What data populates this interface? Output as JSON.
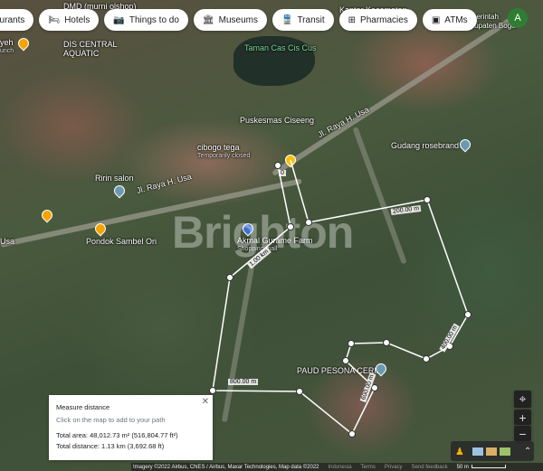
{
  "filter_chips": [
    {
      "label": "aurants",
      "icon": "restaurant-icon"
    },
    {
      "label": "Hotels",
      "icon": "bed-icon"
    },
    {
      "label": "Things to do",
      "icon": "camera-icon"
    },
    {
      "label": "Museums",
      "icon": "museum-icon"
    },
    {
      "label": "Transit",
      "icon": "train-icon"
    },
    {
      "label": "Pharmacies",
      "icon": "pharmacy-icon"
    },
    {
      "label": "ATMs",
      "icon": "atm-icon"
    }
  ],
  "account_initial": "A",
  "map_labels": {
    "dmd": "DMD (murni olshop)",
    "kantor": "Kantor Kecamatan",
    "pemerintah_1": "Pemerintah",
    "pemerintah_2": "Kabupaten Bogor",
    "taman": "Taman Cas Cis Cus",
    "dis_central_1": "DIS CENTRAL",
    "dis_central_2": "AQUATIC",
    "yeh": "yeh",
    "yeh_sub": "unch",
    "puskesmas": "Puskesmas Ciseeng",
    "jl_raya_1": "Jl. Raya H. Usa",
    "jl_raya_2": "Jl. Raya H. Usa",
    "cibogo": "cibogo tega",
    "cibogo_sub": "Temporarily closed",
    "gudang": "Gudang rosebrand",
    "ririn": "Ririn salon",
    "akmal": "Akmal Gurame Farm",
    "akmal_sub": "Shopping mall",
    "pondok": "Pondok Sambel Ori",
    "usa": "Usa",
    "paud": "PAUD PESONA CERIA"
  },
  "watermark": "Brighton",
  "measure": {
    "segment_labels": [
      "0",
      "1.00 km",
      "200.00 m",
      "400.00 m",
      "600.00 m",
      "800.00 m"
    ],
    "path_color": "#ffffff"
  },
  "panel": {
    "title": "Measure distance",
    "hint": "Click on the map to add to your path",
    "total_area": "Total area: 48,012.73 m² (516,804.77 ft²)",
    "total_distance": "Total distance: 1.13 km (3,692.68 ft)",
    "close_icon": "close-icon"
  },
  "controls": {
    "locate": "⌖",
    "zoom_in": "+",
    "zoom_out": "−",
    "expand": "⌃"
  },
  "footer": {
    "attribution": "Imagery ©2022 Airbus, CNES / Airbus, Maxar Technologies, Map data ©2022",
    "country": "Indonesia",
    "terms": "Terms",
    "privacy": "Privacy",
    "feedback": "Send feedback",
    "scale": "50 m"
  }
}
